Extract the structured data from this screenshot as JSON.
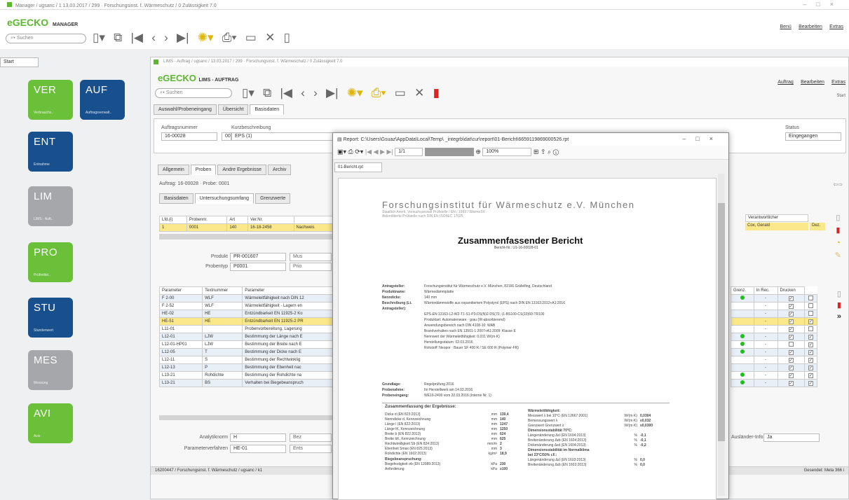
{
  "outer": {
    "title": "Manager / ugsanc / 1 13.03.2017 / 299 · Forschungsinst. f. Wärmeschutz / 0 Zulässigkeit 7.0",
    "logo_brand": "eGECKO",
    "logo_product": "MANAGER",
    "search_placeholder": "Suchen",
    "menu": [
      "Benü",
      "Bearbeiten",
      "Extras"
    ],
    "tab": "Start"
  },
  "tiles": [
    {
      "code": "VER",
      "sub": "Verbrauchs..",
      "color": "green"
    },
    {
      "code": "AUF",
      "sub": "Auftragsverwalt..",
      "color": "navy"
    },
    {
      "code": "ENT",
      "sub": "Entnahme",
      "color": "navy"
    },
    {
      "code": "LIM",
      "sub": "LIMS - Auft..",
      "color": "grey"
    },
    {
      "code": "PRO",
      "sub": "Prüfmittel..",
      "color": "green"
    },
    {
      "code": "STU",
      "sub": "Stundenwert",
      "color": "navy"
    },
    {
      "code": "MES",
      "sub": "Messung",
      "color": "grey"
    },
    {
      "code": "AVI",
      "sub": "Avis",
      "color": "green"
    }
  ],
  "lims": {
    "title": "LIMS - Auftrag / ugsanc / 13.03.2017 / 299 · Forschungsinst. f. Wärmeschutz / 0 Zulässigkeit 7.0",
    "logo_brand": "eGECKO",
    "logo_product": "LIMS - AUFTRAG",
    "search_placeholder": "Suchen",
    "menu": [
      "Auftrag",
      "Bearbeiten",
      "Extras"
    ],
    "extra": "Start",
    "tabs": [
      "Auswahl/Probeneingang",
      "Übersicht",
      "Basisdaten"
    ],
    "auftragsnummer_label": "Auftragsnummer",
    "auftragsnummer": "16-00028",
    "kurz_label": "Kurzbeschreibung",
    "kurz_num": "000",
    "kurz": "EPS (1)",
    "status_label": "Status",
    "status": "Eingegangen",
    "subtabs": [
      "Allgemein",
      "Proben",
      "Andre Ergebnisse",
      "Archiv"
    ],
    "breadcrumb": "Auftrag: 16-00028 · Probe: 0001",
    "subsubtabs": [
      "Basisdaten",
      "Untersuchungsumfang",
      "Grenzwerte"
    ],
    "probe_headers": [
      "Lfd.(i)",
      "Probennr.",
      "Art",
      "Ver.Nr."
    ],
    "probe_row": [
      "1",
      "0001",
      "140",
      "16-18-2458",
      "Nachweis"
    ],
    "sachbearb_header": "Verantwortlicher",
    "sachbearb_value": "Cox, Gerald",
    "sachbearb_extra": "Dez.",
    "produkt_label": "Produkt",
    "produkt": "PR-001607",
    "produkt_side": "Mus",
    "probentyp_label": "Probentyp",
    "probentyp": "P0001",
    "probentyp_side": "Prio",
    "param_headers": [
      "Parameter",
      "Textnummer",
      "Parameter"
    ],
    "params": [
      [
        "F 2-00",
        "WLF",
        "Wärmeleitfähigkeit nach DIN 12",
        "blue"
      ],
      [
        "F 2-52",
        "WLF",
        "Wärmeleitfähigkeit · Lagern en",
        "white"
      ],
      [
        "HE-02",
        "HE",
        "Entzündbarkeit EN 11925-2 Ko",
        "blue"
      ],
      [
        "HE-51",
        "HE",
        "Entzündbarkeit EN 11925-2 PR",
        "hl"
      ],
      [
        "L11-01",
        "",
        "Probenvorbereitung, Lagerung",
        "white"
      ],
      [
        "L12-01",
        "LJW",
        "Bestimmung der Länge nach E",
        "blue"
      ],
      [
        "L12-01-HP01",
        "LJW",
        "Bestimmung der Breite nach E",
        "white"
      ],
      [
        "L12-05",
        "T",
        "Bestimmung der Dicke nach E",
        "blue"
      ],
      [
        "L12-11",
        "S",
        "Bestimmung der Rechtwinklig",
        "white"
      ],
      [
        "L12-13",
        "P",
        "Bestimmung der Ebenheit nac",
        "blue"
      ],
      [
        "L13-21",
        "Rohdichte",
        "Bestimmung der Rohdichte na",
        "white"
      ],
      [
        "L13-21",
        "BS",
        "Verhalten bei Biegebeanspruch",
        "blue"
      ]
    ],
    "right_headers": [
      "Grenz.",
      "In Rec.",
      "Drucken"
    ],
    "right_rows": [
      [
        1,
        "-",
        1,
        0
      ],
      [
        0,
        "-",
        1,
        0
      ],
      [
        0,
        "-",
        1,
        0
      ],
      [
        0,
        "-",
        1,
        1
      ],
      [
        0,
        "-",
        1,
        0
      ],
      [
        1,
        "-",
        1,
        1
      ],
      [
        1,
        "-",
        0,
        1
      ],
      [
        1,
        "-",
        1,
        1
      ],
      [
        0,
        "-",
        1,
        1
      ],
      [
        0,
        "-",
        1,
        1
      ],
      [
        1,
        "-",
        1,
        1
      ],
      [
        1,
        "-",
        1,
        1
      ]
    ],
    "analyt_label": "Analytiknorm",
    "analyt": "H",
    "analyt_side": "Bez",
    "pverf_label": "Parameterverfahren",
    "pverf": "HE-01",
    "pverf_side": "Ents",
    "ausland_label": "Ausländer-Info:",
    "ausland": "Ja",
    "status_bar": "16200447 / Forschungsinst. f. Wärmeschutz / ugsanc / k1",
    "status_bar_right": "Gesendet: Meta 366 i"
  },
  "report": {
    "title": "Report: C:\\Users\\Gsuaz\\AppData\\Local\\Temp\\ _integrb\\dat\\cur\\report\\01-Bericht\\6659119869000526.rpt",
    "page": "1/1",
    "zoom": "100%",
    "tab": "01-Bericht.rpt",
    "institute": "Forschungsinstitut für Wärmeschutz e.V. München",
    "inst_sub1": "Staatlich Anerk. Versuchsanstalt Prüfstelle / EN / 1999 / WärmeSV",
    "inst_sub2": "Akkreditierte Prüfstelle nach DIN EN ISO/IEC 17025",
    "heading": "Zusammenfassender Bericht",
    "report_no": "Bericht-Nr.: U1-16-00028-01",
    "meta": [
      [
        "Antragsteller:",
        "Forschungsinstitut für Wärmeschutz e.V. München, 82166 Gräfelfing, Deutschland"
      ],
      [
        "Produktname:",
        "Wärmedämmplatte"
      ],
      [
        "Nenndicke:",
        "140 mm"
      ],
      [
        "Beschreibung (Lt. Antragsteller):",
        "Wärmedämmstoffe aus expandiertem Polystyrol (EPS) nach DIN EN 13163:2012+A1:2016"
      ],
      [
        "",
        "EPS-EN 13163-L2-W2-T1-S1-P3-DS(N)2-DS(70,-)1-BS100-CS(10)60-TR100"
      ],
      [
        "",
        "Produktart: Automatenware · grau (IR-absorbierend)"
      ],
      [
        "",
        "Anwendungsbereich nach DIN 4108-10: WAB"
      ],
      [
        "",
        "Brandverhalten nach EN 13501-1:2007+A1:2009: Klasse E"
      ],
      [
        "",
        "Nennwert der Wärmeleitfähigkeit: 0,031 W/(m·K)"
      ],
      [
        "",
        "Herstellungsdatum: 02.03.2016"
      ],
      [
        "",
        "Rohstoff: Neopor · Bauer SF 400 R / SE 600 R (Polymer-FR)"
      ]
    ],
    "meta2": [
      [
        "Grundlage:",
        "Regelprüfung 2016"
      ],
      [
        "Probenahme:",
        "Im Herstellwerk am 14.03.2016"
      ],
      [
        "Probeneingang:",
        "WE16-2400 vom 22.03.2016 (Interne Nr. 1)"
      ]
    ],
    "summary_title": "Zusammenfassung der Ergebnisse:",
    "left_results": [
      [
        "Dicke d (EN 823:2013)",
        "mm",
        "139,4"
      ],
      [
        "Nenndicke d, Kennzeichnung",
        "mm",
        "140"
      ],
      [
        "Länge l (EN 822:2013)",
        "mm",
        "1247"
      ],
      [
        "Länge lK, Kennzeichnung",
        "mm",
        "1250"
      ],
      [
        "Breite b (EN 822:2013)",
        "mm",
        "624"
      ],
      [
        "Breite bK, Kennzeichnung",
        "mm",
        "625"
      ],
      [
        "Rechtwinkligkeit Sb (EN 824:2013)",
        "mm/m",
        "2"
      ],
      [
        "Ebenheit Smax (EN 825:2013)",
        "mm",
        "3"
      ],
      [
        "Rohdichte (EN 1602:2013)",
        "kg/m³",
        "18,9"
      ]
    ],
    "left_sub": "Biegebeanspruchung:",
    "left_results2": [
      [
        "Biegefestigkeit σb (EN 12089:2013)",
        "kPa",
        "230"
      ],
      [
        "Anforderung",
        "kPa",
        "≥100"
      ]
    ],
    "right_results": [
      [
        "Wärmeleitfähigkeit:",
        "",
        "",
        ""
      ],
      [
        "Messwert λ bei 10°C (EN 12667:2001)",
        "W/(m·K)",
        "0,0304"
      ],
      [
        "Bemessungswert λ",
        "W/(m·K)",
        "≤0,032"
      ],
      [
        "Grenzwert Grenzwert λ",
        "W/(m·K)",
        "≤0,0300"
      ],
      [
        "Dimensionsstabilität 70°C:",
        "",
        "",
        ""
      ],
      [
        "Längenänderung Δεl (EN 1604:2013)",
        "%",
        "-0,1"
      ],
      [
        "Breitenänderung Δεb (EN 1604:2013)",
        "%",
        "-0,1"
      ],
      [
        "Dickenänderung Δεd (EN 1604:2013)",
        "%",
        "-0,2"
      ],
      [
        "Dimensionsstabilität im Normalklima",
        "",
        "",
        ""
      ],
      [
        "bei 23°C/50% r.F.:",
        "",
        "",
        ""
      ],
      [
        "Längenänderung Δεl (EN 1603:2013)",
        "%",
        "0,0"
      ],
      [
        "Breitenänderung Δεb (EN 1603:2013)",
        "%",
        "0,0"
      ]
    ]
  }
}
